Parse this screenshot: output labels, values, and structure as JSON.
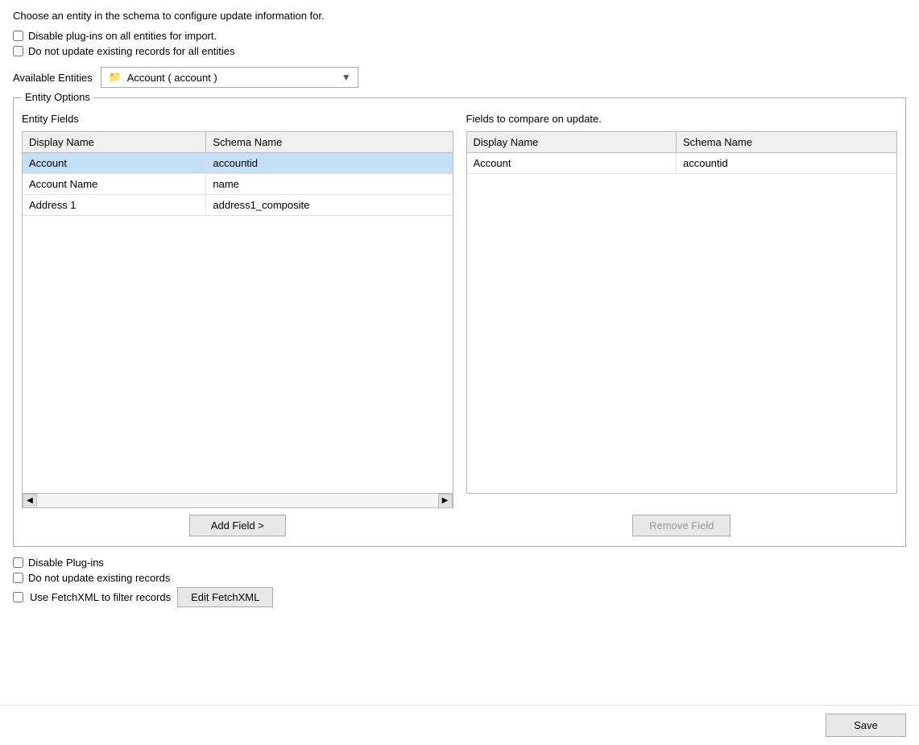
{
  "page": {
    "intro_text": "Choose an entity in the schema to configure update information for.",
    "global_checkboxes": [
      {
        "label": "Disable plug-ins on all entities for import.",
        "checked": false
      },
      {
        "label": "Do not update existing records for all entities",
        "checked": false
      }
    ],
    "entity_selector": {
      "label": "Available Entities",
      "value": "Account  (  account  )",
      "icon": "📁"
    },
    "entity_options": {
      "group_label": "Entity Options",
      "left_panel": {
        "title": "Entity Fields",
        "table": {
          "columns": [
            "Display Name",
            "Schema Name"
          ],
          "rows": [
            {
              "display_name": "Account",
              "schema_name": "accountid",
              "selected": true
            },
            {
              "display_name": "Account Name",
              "schema_name": "name",
              "selected": false
            },
            {
              "display_name": "Address 1",
              "schema_name": "address1_composite",
              "selected": false
            }
          ]
        }
      },
      "right_panel": {
        "title": "Fields to compare on update.",
        "table": {
          "columns": [
            "Display Name",
            "Schema Name"
          ],
          "rows": [
            {
              "display_name": "Account",
              "schema_name": "accountid"
            }
          ]
        }
      },
      "add_button_label": "Add Field >",
      "remove_button_label": "Remove Field"
    },
    "entity_checkboxes": [
      {
        "label": "Disable Plug-ins",
        "checked": false
      },
      {
        "label": "Do not update existing records",
        "checked": false
      },
      {
        "label": "Use FetchXML to filter records",
        "checked": false
      }
    ],
    "fetchxml_button_label": "Edit FetchXML",
    "save_button_label": "Save"
  }
}
